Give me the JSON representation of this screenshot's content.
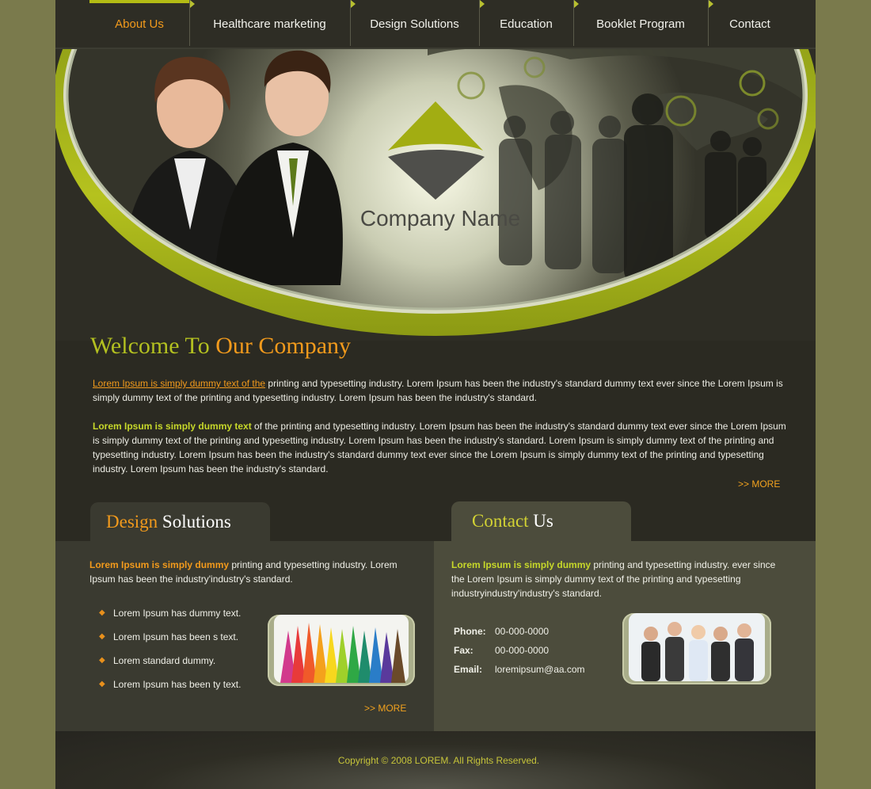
{
  "colors": {
    "page_bg": "#7a7a4c",
    "site_bg": "#2b2a22",
    "accent_green": "#b3bb14",
    "accent_orange": "#f29a1c"
  },
  "nav": {
    "items": [
      {
        "label": "About Us",
        "active": true
      },
      {
        "label": "Healthcare marketing",
        "active": false
      },
      {
        "label": "Design Solutions",
        "active": false
      },
      {
        "label": "Education",
        "active": false
      },
      {
        "label": "Booklet Program",
        "active": false
      },
      {
        "label": "Contact",
        "active": false
      }
    ]
  },
  "banner": {
    "company_name": "Company Name"
  },
  "welcome": {
    "title_part1": "Welcome To ",
    "title_part2": "Our Company",
    "p1_link": "Lorem Ipsum is simply dummy text of the",
    "p1_rest": " printing and typesetting industry. Lorem Ipsum has been the industry's standard dummy text ever since the Lorem Ipsum is simply dummy text of the printing and typesetting industry. Lorem Ipsum has been the industry's standard.",
    "p2_lead": "Lorem Ipsum is simply dummy text",
    "p2_rest": " of the printing and typesetting industry. Lorem Ipsum has been the industry's standard dummy text ever since the Lorem Ipsum is simply dummy text of the printing and typesetting industry. Lorem Ipsum has been the industry's standard. Lorem Ipsum is simply dummy text of the printing and typesetting industry. Lorem Ipsum has been the industry's standard dummy text ever since the Lorem Ipsum is simply dummy text of the printing and typesetting industry. Lorem Ipsum has been the industry's standard.",
    "more": ">> MORE"
  },
  "design_solutions": {
    "tab_part1": "Design",
    "tab_part2": " Solutions",
    "lead": "Lorem Ipsum is simply dummy",
    "text": " printing and typesetting industry. Lorem Ipsum has been the industry'industry's standard.",
    "bullets": [
      "Lorem Ipsum has dummy text.",
      "Lorem Ipsum has been s text.",
      "Lorem standard dummy.",
      "Lorem Ipsum has been ty text."
    ],
    "more": ">> MORE"
  },
  "contact": {
    "tab_part1": "Contact",
    "tab_part2": " Us",
    "lead": "Lorem Ipsum is simply dummy",
    "text": " printing and typesetting industry. ever since the Lorem Ipsum is simply dummy text of the printing and typesetting industryindustry'industry's standard.",
    "phone_label": "Phone:",
    "phone": "00-000-0000",
    "fax_label": "Fax:",
    "fax": "00-000-0000",
    "email_label": "Email:",
    "email": "loremipsum@aa.com"
  },
  "footer": {
    "copyright": "Copyright © 2008 LOREM. All Rights Reserved."
  }
}
